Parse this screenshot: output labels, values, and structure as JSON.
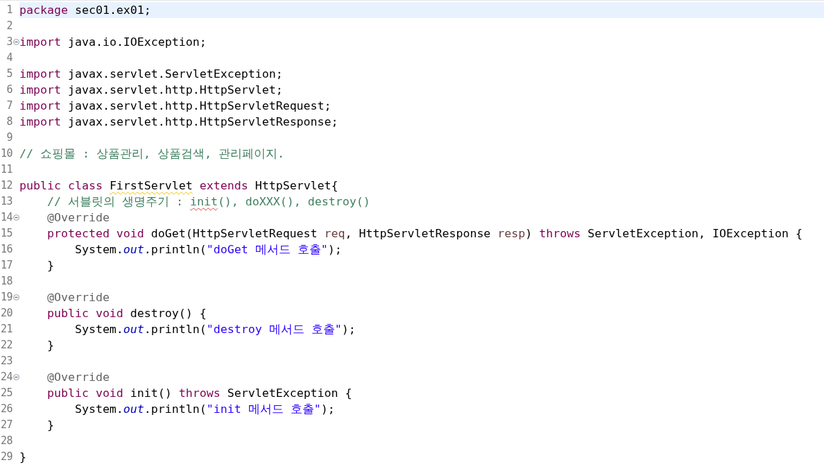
{
  "editor": {
    "lines": [
      {
        "number": "1",
        "current": true,
        "foldable": false,
        "tokens": [
          {
            "kind": "keyword",
            "text": "package"
          },
          {
            "kind": "plain",
            "text": " sec01.ex01;"
          }
        ]
      },
      {
        "number": "2",
        "current": false,
        "foldable": false
      },
      {
        "number": "3",
        "current": false,
        "foldable": true,
        "tokens": [
          {
            "kind": "keyword",
            "text": "import"
          },
          {
            "kind": "plain",
            "text": " java.io.IOException;"
          }
        ]
      },
      {
        "number": "4",
        "current": false,
        "foldable": false
      },
      {
        "number": "5",
        "current": false,
        "foldable": false,
        "tokens": [
          {
            "kind": "keyword",
            "text": "import"
          },
          {
            "kind": "plain",
            "text": " javax.servlet.ServletException;"
          }
        ]
      },
      {
        "number": "6",
        "current": false,
        "foldable": false,
        "tokens": [
          {
            "kind": "keyword",
            "text": "import"
          },
          {
            "kind": "plain",
            "text": " javax.servlet.http.HttpServlet;"
          }
        ]
      },
      {
        "number": "7",
        "current": false,
        "foldable": false,
        "tokens": [
          {
            "kind": "keyword",
            "text": "import"
          },
          {
            "kind": "plain",
            "text": " javax.servlet.http.HttpServletRequest;"
          }
        ]
      },
      {
        "number": "8",
        "current": false,
        "foldable": false,
        "tokens": [
          {
            "kind": "keyword",
            "text": "import"
          },
          {
            "kind": "plain",
            "text": " javax.servlet.http.HttpServletResponse;"
          }
        ]
      },
      {
        "number": "9",
        "current": false,
        "foldable": false
      },
      {
        "number": "10",
        "current": false,
        "foldable": false,
        "tokens": [
          {
            "kind": "comment",
            "text": "// 쇼핑몰 : 상품관리, 상품검색, 관리페이지."
          }
        ]
      },
      {
        "number": "11",
        "current": false,
        "foldable": false
      },
      {
        "number": "12",
        "current": false,
        "foldable": false,
        "tokens": [
          {
            "kind": "keyword",
            "text": "public class "
          },
          {
            "kind": "plain",
            "text": "FirstServlet",
            "warning": true
          },
          {
            "kind": "keyword",
            "text": " extends"
          },
          {
            "kind": "plain",
            "text": " HttpServlet{"
          }
        ]
      },
      {
        "number": "13",
        "current": false,
        "foldable": false,
        "tokens": [
          {
            "kind": "comment",
            "text": "    // 서블릿의 생명주기 : "
          },
          {
            "kind": "comment",
            "text": "init",
            "misspelled": true
          },
          {
            "kind": "comment",
            "text": "(), doXXX(), destroy()"
          }
        ]
      },
      {
        "number": "14",
        "current": false,
        "foldable": true,
        "tokens": [
          {
            "kind": "annotation",
            "text": "    @Override"
          }
        ]
      },
      {
        "number": "15",
        "current": false,
        "foldable": false,
        "tokens": [
          {
            "kind": "keyword",
            "text": "    protected void"
          },
          {
            "kind": "plain",
            "text": " doGet(HttpServletRequest "
          },
          {
            "kind": "parameter",
            "text": "req"
          },
          {
            "kind": "plain",
            "text": ", HttpServletResponse "
          },
          {
            "kind": "parameter",
            "text": "resp"
          },
          {
            "kind": "plain",
            "text": ") "
          },
          {
            "kind": "keyword",
            "text": "throws"
          },
          {
            "kind": "plain",
            "text": " ServletException, IOException {"
          }
        ]
      },
      {
        "number": "16",
        "current": false,
        "foldable": false,
        "tokens": [
          {
            "kind": "plain",
            "text": "        System."
          },
          {
            "kind": "field",
            "text": "out"
          },
          {
            "kind": "plain",
            "text": ".println("
          },
          {
            "kind": "string",
            "text": "\"doGet 메서드 호출\""
          },
          {
            "kind": "plain",
            "text": ");"
          }
        ]
      },
      {
        "number": "17",
        "current": false,
        "foldable": false,
        "tokens": [
          {
            "kind": "plain",
            "text": "    }"
          }
        ]
      },
      {
        "number": "18",
        "current": false,
        "foldable": false
      },
      {
        "number": "19",
        "current": false,
        "foldable": true,
        "tokens": [
          {
            "kind": "annotation",
            "text": "    @Override"
          }
        ]
      },
      {
        "number": "20",
        "current": false,
        "foldable": false,
        "tokens": [
          {
            "kind": "keyword",
            "text": "    public void"
          },
          {
            "kind": "plain",
            "text": " destroy() {"
          }
        ]
      },
      {
        "number": "21",
        "current": false,
        "foldable": false,
        "tokens": [
          {
            "kind": "plain",
            "text": "        System."
          },
          {
            "kind": "field",
            "text": "out"
          },
          {
            "kind": "plain",
            "text": ".println("
          },
          {
            "kind": "string",
            "text": "\"destroy 메서드 호출\""
          },
          {
            "kind": "plain",
            "text": ");"
          }
        ]
      },
      {
        "number": "22",
        "current": false,
        "foldable": false,
        "tokens": [
          {
            "kind": "plain",
            "text": "    }"
          }
        ]
      },
      {
        "number": "23",
        "current": false,
        "foldable": false
      },
      {
        "number": "24",
        "current": false,
        "foldable": true,
        "tokens": [
          {
            "kind": "annotation",
            "text": "    @Override"
          }
        ]
      },
      {
        "number": "25",
        "current": false,
        "foldable": false,
        "tokens": [
          {
            "kind": "keyword",
            "text": "    public void"
          },
          {
            "kind": "plain",
            "text": " init() "
          },
          {
            "kind": "keyword",
            "text": "throws"
          },
          {
            "kind": "plain",
            "text": " ServletException {"
          }
        ]
      },
      {
        "number": "26",
        "current": false,
        "foldable": false,
        "tokens": [
          {
            "kind": "plain",
            "text": "        System."
          },
          {
            "kind": "field",
            "text": "out"
          },
          {
            "kind": "plain",
            "text": ".println("
          },
          {
            "kind": "string",
            "text": "\"init 메서드 호출\""
          },
          {
            "kind": "plain",
            "text": ");"
          }
        ]
      },
      {
        "number": "27",
        "current": false,
        "foldable": false,
        "tokens": [
          {
            "kind": "plain",
            "text": "    }"
          }
        ]
      },
      {
        "number": "28",
        "current": false,
        "foldable": false
      },
      {
        "number": "29",
        "current": false,
        "foldable": false,
        "tokens": [
          {
            "kind": "plain",
            "text": "}"
          }
        ]
      }
    ]
  }
}
